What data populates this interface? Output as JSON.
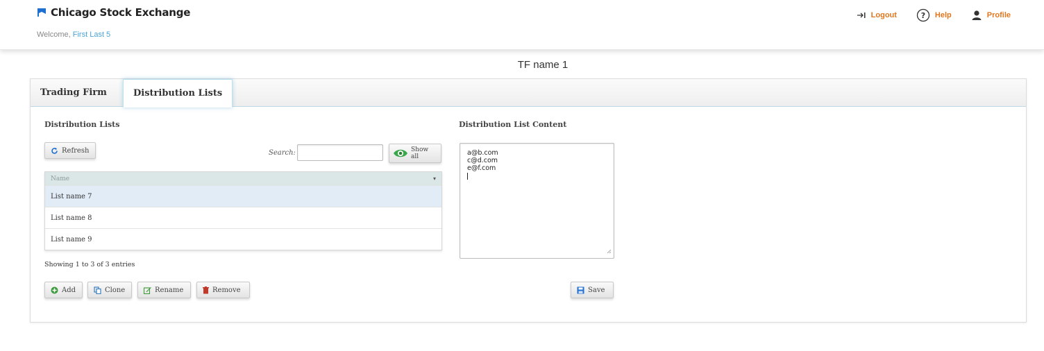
{
  "header": {
    "brand": "Chicago Stock Exchange",
    "welcome_prefix": "Welcome,",
    "user_name": "First Last 5",
    "nav": {
      "logout": "Logout",
      "help": "Help",
      "profile": "Profile"
    }
  },
  "page": {
    "title": "TF name 1"
  },
  "tabs": [
    {
      "label": "Trading Firm"
    },
    {
      "label": "Distribution Lists"
    }
  ],
  "lists_section": {
    "title": "Distribution Lists",
    "refresh_label": "Refresh",
    "search_label": "Search:",
    "search_value": "",
    "show_all_label": "Show all",
    "table": {
      "column": "Name",
      "rows": [
        "List name 7",
        "List name 8",
        "List name 9"
      ]
    },
    "showing": "Showing 1 to 3 of 3 entries",
    "actions": {
      "add": "Add",
      "clone": "Clone",
      "rename": "Rename",
      "remove": "Remove"
    }
  },
  "content_section": {
    "title": "Distribution List Content",
    "lines": [
      "a@b.com",
      "c@d.com",
      "e@f.com"
    ],
    "save_label": "Save"
  },
  "colors": {
    "brand_blue": "#1f6fd1",
    "accent_orange": "#e2761d",
    "link_blue": "#4aa3d6",
    "add_green": "#3a9a3a",
    "remove_red": "#c0392b",
    "show_all_green": "#3aa84a"
  },
  "icons": {
    "brand": "flag-icon",
    "logout": "logout-arrow-icon",
    "help": "question-circle-icon",
    "profile": "user-icon",
    "refresh": "refresh-icon",
    "show_all": "eye-icon",
    "add": "plus-circle-icon",
    "clone": "copy-icon",
    "rename": "edit-icon",
    "remove": "trash-icon",
    "save": "save-icon"
  }
}
